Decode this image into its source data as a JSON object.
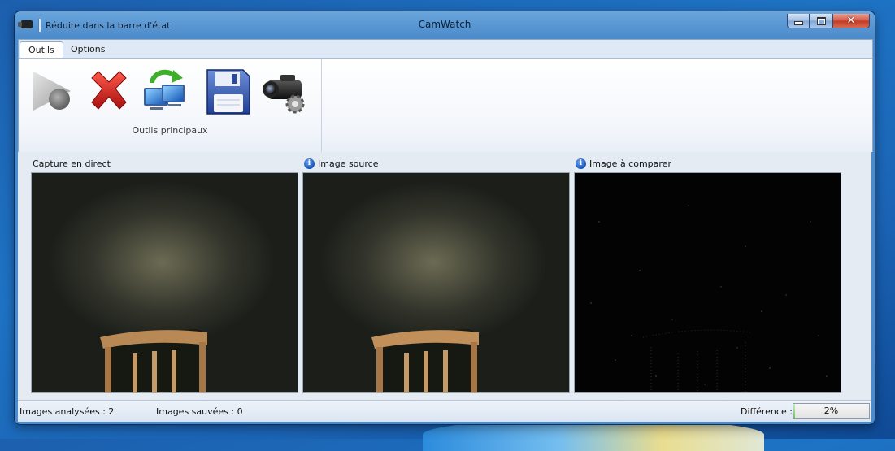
{
  "window": {
    "title": "CamWatch",
    "quick_access_label": "Réduire dans la barre d'état",
    "caption_buttons": [
      "minimize-icon",
      "maximize-icon",
      "close-icon"
    ]
  },
  "ribbon": {
    "tabs": [
      {
        "label": "Outils",
        "active": true
      },
      {
        "label": "Options",
        "active": false
      }
    ],
    "group": {
      "label": "Outils principaux",
      "tools": [
        "play-record-icon",
        "delete-x-icon",
        "refresh-computer-icon",
        "save-floppy-icon",
        "camcorder-settings-icon"
      ]
    }
  },
  "panes": [
    {
      "label": "Capture en direct",
      "info_icon": false
    },
    {
      "label": "Image source",
      "info_icon": true
    },
    {
      "label": "Image à comparer",
      "info_icon": true
    }
  ],
  "status": {
    "images_analyzed": "Images analysées : 2",
    "images_saved": "Images sauvées : 0",
    "difference_label": "Différence :",
    "difference_value": "2%",
    "difference_fraction": 0.02
  },
  "colors": {
    "desktop": "#1e73c4",
    "window_frame": "#4d8ccc",
    "ribbon_bg": "#dfe9f5",
    "content_bg": "#e4ebf3",
    "progress_fill": "#6ec05e"
  }
}
